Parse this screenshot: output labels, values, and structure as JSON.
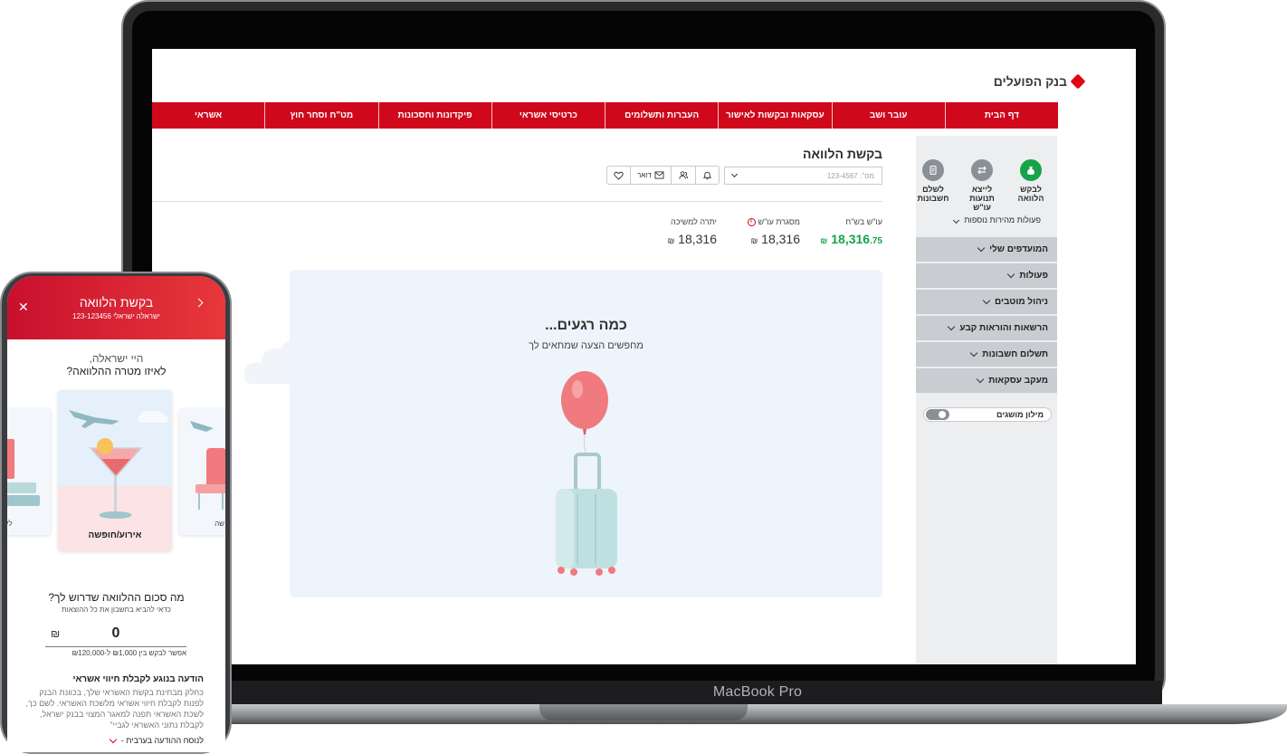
{
  "laptop": {
    "brand_label": "MacBook Pro"
  },
  "bank": {
    "logo_text": "בנק הפועלים",
    "nav": [
      "דף הבית",
      "עובר ושב",
      "עסקאות ובקשות לאישור",
      "העברות ותשלומים",
      "כרטיסי אשראי",
      "פיקדונות וחסכונות",
      "מט\"ח וסחר חוץ",
      "אשראי"
    ],
    "quick_actions": [
      {
        "label": "לבקש הלוואה",
        "icon": "money-bag-icon"
      },
      {
        "label": "לייצא תנועות עו\"ש",
        "icon": "export-icon"
      },
      {
        "label": "לשלם חשבונות",
        "icon": "bill-icon"
      }
    ],
    "more_actions": "פעולות מהירות נוספות",
    "menu": [
      "המועדפים שלי",
      "פעולות",
      "ניהול מוטבים",
      "הרשאות והוראות קבע",
      "תשלום חשבונות",
      "מעקב עסקאות"
    ],
    "glossary": "מילון מושגים",
    "page_title": "בקשת הלוואה",
    "account_placeholder": "מס׳: 123-4567",
    "toolbar": {
      "mail": "דואר"
    },
    "balances": [
      {
        "label": "עו\"ש בש\"ח",
        "value": "18,316",
        "decimal": ".75",
        "currency": "₪",
        "color": "#16a34a"
      },
      {
        "label": "מסגרת עו\"ש",
        "value": "18,316",
        "currency": "₪"
      },
      {
        "label": "יתרה למשיכה",
        "value": "18,316",
        "currency": "₪"
      }
    ],
    "loading": {
      "title": "כמה רגעים...",
      "subtitle": "מחפשים הצעה שמתאים לך"
    },
    "colors": {
      "brand_red": "#d0081b",
      "positive_green": "#16a34a",
      "sidebar_bg": "#eceef0",
      "panel_bg": "#eef4fb"
    }
  },
  "phone": {
    "title": "בקשת הלוואה",
    "subtitle": "ישראלה ישראלי 123-123456",
    "greeting": "היי ישראלה,",
    "question": "לאיזו מטרה ההלוואה?",
    "cards": [
      {
        "label": "אירוע/חופשה"
      },
      {
        "label": "לימ"
      },
      {
        "label": "שה"
      }
    ],
    "amount_question": "מה סכום ההלוואה שדרוש לך?",
    "amount_hint": "כדאי להביא בחשבון את כל ההוצאות",
    "amount_value": "0",
    "amount_currency": "₪",
    "amount_range": "אפשר לבקש בין ₪1,000 ל-₪120,000",
    "notice_title": "הודעה בנוגע לקבלת חיווי אשראי",
    "notice_text": "כחלק מבחינת בקשת האשראי שלך, בכוונת הבנק לפנות לקבלת חיווי אשראי מלשכת האשראי. לשם כך, לשכת האשראי תפנה למאגר המצוי בבנק ישראל, לקבלת נתוני האשראי לגביי\"",
    "notice_link": "לנוסח ההודעה בערבית -"
  }
}
